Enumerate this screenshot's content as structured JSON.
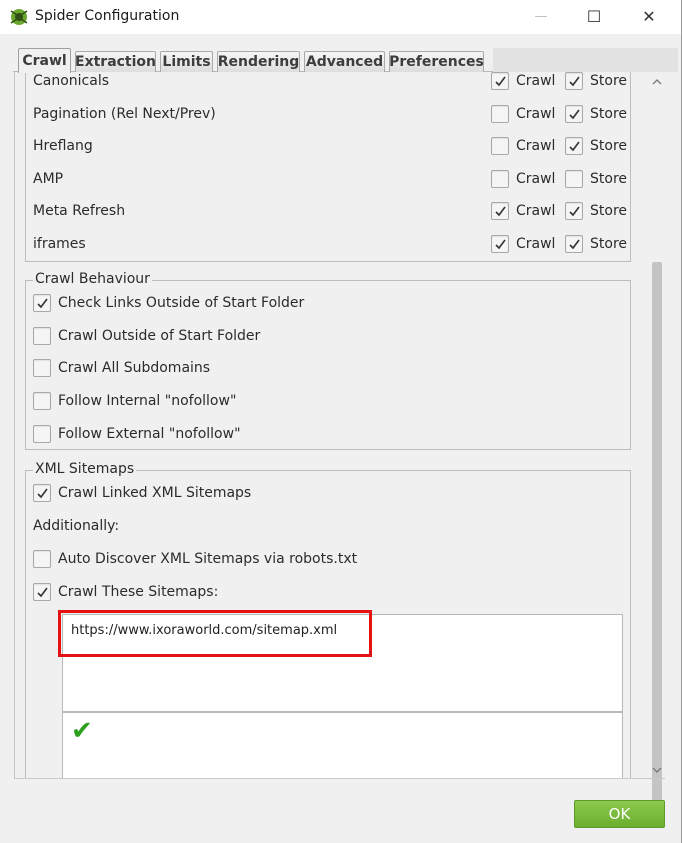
{
  "window": {
    "title": "Spider Configuration",
    "minimize_glyph": "—",
    "maximize_glyph": "☐",
    "close_glyph": "✕"
  },
  "tabs": [
    {
      "label": "Crawl",
      "active": true
    },
    {
      "label": "Extraction",
      "active": false
    },
    {
      "label": "Limits",
      "active": false
    },
    {
      "label": "Rendering",
      "active": false
    },
    {
      "label": "Advanced",
      "active": false
    },
    {
      "label": "Preferences",
      "active": false
    }
  ],
  "resource_rows": [
    {
      "label": "Canonicals",
      "crawl_label": "Crawl",
      "crawl": true,
      "store_label": "Store",
      "store": true
    },
    {
      "label": "Pagination (Rel Next/Prev)",
      "crawl_label": "Crawl",
      "crawl": false,
      "store_label": "Store",
      "store": true
    },
    {
      "label": "Hreflang",
      "crawl_label": "Crawl",
      "crawl": false,
      "store_label": "Store",
      "store": true
    },
    {
      "label": "AMP",
      "crawl_label": "Crawl",
      "crawl": false,
      "store_label": "Store",
      "store": false
    },
    {
      "label": "Meta Refresh",
      "crawl_label": "Crawl",
      "crawl": true,
      "store_label": "Store",
      "store": true
    },
    {
      "label": "iframes",
      "crawl_label": "Crawl",
      "crawl": true,
      "store_label": "Store",
      "store": true
    }
  ],
  "crawl_behaviour": {
    "legend": "Crawl Behaviour",
    "items": [
      {
        "label": "Check Links Outside of Start Folder",
        "checked": true
      },
      {
        "label": "Crawl Outside of Start Folder",
        "checked": false
      },
      {
        "label": "Crawl All Subdomains",
        "checked": false
      },
      {
        "label": "Follow Internal \"nofollow\"",
        "checked": false
      },
      {
        "label": "Follow External \"nofollow\"",
        "checked": false
      }
    ]
  },
  "xml_sitemaps": {
    "legend": "XML Sitemaps",
    "crawl_linked": {
      "label": "Crawl Linked XML Sitemaps",
      "checked": true
    },
    "additionally_label": "Additionally:",
    "auto_discover": {
      "label": "Auto Discover XML Sitemaps via robots.txt",
      "checked": false
    },
    "crawl_these": {
      "label": "Crawl These Sitemaps:",
      "checked": true
    },
    "sitemap_urls": "https://www.ixoraworld.com/sitemap.xml",
    "validation_glyph": "✔"
  },
  "footer": {
    "ok_label": "OK"
  },
  "colors": {
    "highlight": "#e41212",
    "ok_button": "#7abb3b",
    "valid_check": "#2e9e1e"
  }
}
